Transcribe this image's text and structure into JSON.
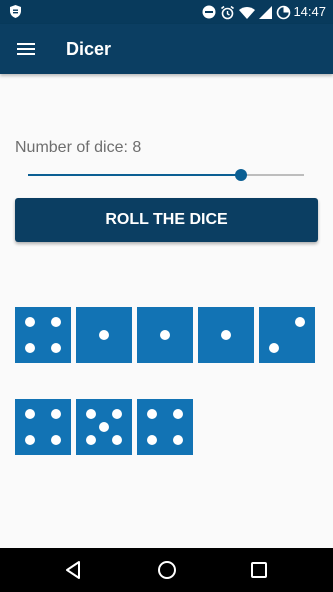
{
  "status_bar": {
    "time": "14:47",
    "icons": [
      "shield-icon",
      "do-not-disturb-icon",
      "alarm-icon",
      "wifi-icon",
      "cellular-signal-icon",
      "battery-icon"
    ]
  },
  "app_bar": {
    "title": "Dicer",
    "menu_icon": "hamburger-menu-icon"
  },
  "main": {
    "dice_count_label": "Number of dice: 8",
    "slider_value_fraction": 0.77,
    "roll_button_label": "ROLL THE DICE",
    "dice_color": "#1273b4",
    "dice_values": [
      4,
      1,
      1,
      1,
      2,
      4,
      5,
      4
    ]
  },
  "nav_bar": {
    "buttons": [
      "back-icon",
      "home-icon",
      "recents-icon"
    ]
  },
  "colors": {
    "app_bar": "#0b3e62",
    "status_bar": "#083a5c",
    "accent": "#0b5f93"
  }
}
